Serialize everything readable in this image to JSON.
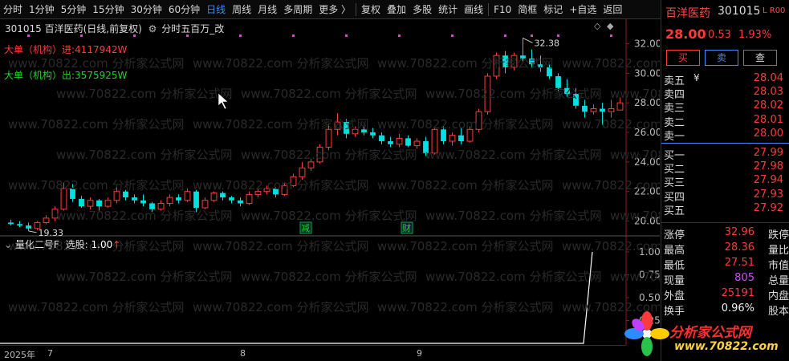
{
  "toolbar": {
    "items": [
      {
        "label": "分时",
        "active": false
      },
      {
        "label": "1分钟",
        "active": false
      },
      {
        "label": "5分钟",
        "active": false
      },
      {
        "label": "15分钟",
        "active": false
      },
      {
        "label": "30分钟",
        "active": false
      },
      {
        "label": "60分钟",
        "active": false
      },
      {
        "label": "日线",
        "active": true
      },
      {
        "label": "周线",
        "active": false
      },
      {
        "label": "月线",
        "active": false
      },
      {
        "label": "多周期",
        "active": false
      },
      {
        "label": "更多 〉",
        "active": false
      },
      {
        "label": "复权",
        "active": false
      },
      {
        "label": "叠加",
        "active": false
      },
      {
        "label": "多股",
        "active": false
      },
      {
        "label": "统计",
        "active": false
      },
      {
        "label": "画线",
        "active": false
      },
      {
        "label": "F10",
        "active": false
      },
      {
        "label": "简框",
        "active": false
      },
      {
        "label": "标记",
        "active": false
      },
      {
        "label": "+自选",
        "active": false
      },
      {
        "label": "返回",
        "active": false
      }
    ]
  },
  "chart": {
    "title": "301015 百洋医药(日线,前复权)",
    "indicator": "分时五百万_改",
    "buy_legend": "大单（机构）进:4117942W",
    "sell_legend": "大单（机构）出:3575925W",
    "pane_label": "量化二号F",
    "pane_select": "选股:",
    "pane_value": "1.00",
    "pane_arrow": "↑",
    "date_labels": [
      "2025年",
      "7",
      "8",
      "9"
    ],
    "high_label": "32.38",
    "low_label": "19.33",
    "event_tags": [
      "减",
      "财"
    ]
  },
  "chart_data": {
    "type": "candlestick",
    "price_ticks": [
      "32.00",
      "30.00",
      "28.00",
      "26.00",
      "24.00",
      "22.00",
      "20.00"
    ],
    "indicator_ticks": [
      "1.00",
      "0.75",
      "0.50",
      "0.25"
    ],
    "candles": [
      {
        "o": 19.9,
        "h": 20.1,
        "l": 19.7,
        "c": 19.8
      },
      {
        "o": 19.8,
        "h": 20.0,
        "l": 19.6,
        "c": 19.7
      },
      {
        "o": 19.7,
        "h": 19.9,
        "l": 19.33,
        "c": 19.5
      },
      {
        "o": 19.5,
        "h": 20.0,
        "l": 19.4,
        "c": 19.9
      },
      {
        "o": 19.9,
        "h": 20.4,
        "l": 19.8,
        "c": 20.2
      },
      {
        "o": 20.2,
        "h": 21.0,
        "l": 20.0,
        "c": 20.8
      },
      {
        "o": 20.8,
        "h": 22.6,
        "l": 20.7,
        "c": 22.2
      },
      {
        "o": 22.2,
        "h": 22.5,
        "l": 21.3,
        "c": 21.5
      },
      {
        "o": 21.5,
        "h": 21.7,
        "l": 20.9,
        "c": 21.0
      },
      {
        "o": 21.0,
        "h": 21.6,
        "l": 20.8,
        "c": 21.4
      },
      {
        "o": 21.4,
        "h": 21.5,
        "l": 20.7,
        "c": 21.0
      },
      {
        "o": 21.0,
        "h": 21.6,
        "l": 20.9,
        "c": 21.4
      },
      {
        "o": 21.4,
        "h": 22.4,
        "l": 21.2,
        "c": 22.0
      },
      {
        "o": 22.0,
        "h": 22.1,
        "l": 21.4,
        "c": 21.6
      },
      {
        "o": 21.6,
        "h": 21.8,
        "l": 21.2,
        "c": 21.4
      },
      {
        "o": 21.4,
        "h": 21.8,
        "l": 21.0,
        "c": 21.2
      },
      {
        "o": 21.2,
        "h": 21.3,
        "l": 20.6,
        "c": 20.8
      },
      {
        "o": 20.8,
        "h": 21.4,
        "l": 20.7,
        "c": 21.2
      },
      {
        "o": 21.2,
        "h": 21.8,
        "l": 21.0,
        "c": 21.6
      },
      {
        "o": 21.6,
        "h": 21.8,
        "l": 21.2,
        "c": 21.4
      },
      {
        "o": 21.4,
        "h": 22.2,
        "l": 21.3,
        "c": 22.0
      },
      {
        "o": 22.0,
        "h": 22.1,
        "l": 20.6,
        "c": 20.9
      },
      {
        "o": 20.9,
        "h": 21.6,
        "l": 20.8,
        "c": 21.4
      },
      {
        "o": 21.4,
        "h": 22.0,
        "l": 21.3,
        "c": 21.9
      },
      {
        "o": 21.9,
        "h": 22.0,
        "l": 21.4,
        "c": 21.6
      },
      {
        "o": 21.6,
        "h": 21.7,
        "l": 21.2,
        "c": 21.4
      },
      {
        "o": 21.4,
        "h": 21.6,
        "l": 21.0,
        "c": 21.2
      },
      {
        "o": 21.2,
        "h": 22.0,
        "l": 21.1,
        "c": 21.8
      },
      {
        "o": 21.8,
        "h": 22.2,
        "l": 21.6,
        "c": 22.0
      },
      {
        "o": 22.0,
        "h": 22.4,
        "l": 21.8,
        "c": 22.2
      },
      {
        "o": 22.2,
        "h": 22.3,
        "l": 21.6,
        "c": 21.8
      },
      {
        "o": 21.8,
        "h": 22.6,
        "l": 21.7,
        "c": 22.4
      },
      {
        "o": 22.4,
        "h": 23.2,
        "l": 22.3,
        "c": 23.0
      },
      {
        "o": 23.0,
        "h": 24.0,
        "l": 22.8,
        "c": 23.6
      },
      {
        "o": 23.6,
        "h": 24.2,
        "l": 23.4,
        "c": 24.0
      },
      {
        "o": 24.0,
        "h": 25.2,
        "l": 23.9,
        "c": 25.0
      },
      {
        "o": 25.0,
        "h": 26.6,
        "l": 24.8,
        "c": 26.2
      },
      {
        "o": 26.2,
        "h": 27.3,
        "l": 25.8,
        "c": 26.7
      },
      {
        "o": 26.7,
        "h": 26.9,
        "l": 25.6,
        "c": 25.9
      },
      {
        "o": 25.9,
        "h": 26.4,
        "l": 25.7,
        "c": 26.2
      },
      {
        "o": 26.2,
        "h": 26.5,
        "l": 25.8,
        "c": 26.0
      },
      {
        "o": 26.0,
        "h": 26.3,
        "l": 25.6,
        "c": 25.8
      },
      {
        "o": 25.8,
        "h": 26.0,
        "l": 25.2,
        "c": 25.4
      },
      {
        "o": 25.4,
        "h": 25.7,
        "l": 25.0,
        "c": 25.2
      },
      {
        "o": 25.2,
        "h": 25.9,
        "l": 25.0,
        "c": 25.6
      },
      {
        "o": 25.6,
        "h": 25.8,
        "l": 25.0,
        "c": 25.1
      },
      {
        "o": 25.1,
        "h": 25.6,
        "l": 24.9,
        "c": 25.4
      },
      {
        "o": 25.4,
        "h": 25.7,
        "l": 24.4,
        "c": 24.6
      },
      {
        "o": 24.6,
        "h": 26.4,
        "l": 24.5,
        "c": 26.2
      },
      {
        "o": 26.2,
        "h": 26.4,
        "l": 25.2,
        "c": 25.4
      },
      {
        "o": 25.4,
        "h": 26.0,
        "l": 25.1,
        "c": 25.8
      },
      {
        "o": 25.8,
        "h": 26.3,
        "l": 25.2,
        "c": 25.4
      },
      {
        "o": 25.4,
        "h": 26.4,
        "l": 25.3,
        "c": 26.2
      },
      {
        "o": 26.2,
        "h": 27.6,
        "l": 26.0,
        "c": 27.4
      },
      {
        "o": 27.4,
        "h": 30.0,
        "l": 27.2,
        "c": 29.8
      },
      {
        "o": 29.8,
        "h": 31.4,
        "l": 29.6,
        "c": 31.2
      },
      {
        "o": 31.2,
        "h": 31.5,
        "l": 30.0,
        "c": 30.4
      },
      {
        "o": 30.4,
        "h": 31.4,
        "l": 30.2,
        "c": 31.2
      },
      {
        "o": 31.2,
        "h": 32.38,
        "l": 30.8,
        "c": 31.0
      },
      {
        "o": 31.0,
        "h": 31.6,
        "l": 30.4,
        "c": 30.6
      },
      {
        "o": 30.6,
        "h": 31.2,
        "l": 30.1,
        "c": 30.4
      },
      {
        "o": 30.4,
        "h": 30.6,
        "l": 29.6,
        "c": 29.8
      },
      {
        "o": 29.8,
        "h": 30.0,
        "l": 28.8,
        "c": 29.0
      },
      {
        "o": 29.0,
        "h": 29.6,
        "l": 28.4,
        "c": 28.6
      },
      {
        "o": 28.6,
        "h": 29.0,
        "l": 27.6,
        "c": 27.8
      },
      {
        "o": 27.8,
        "h": 28.2,
        "l": 27.0,
        "c": 27.4
      },
      {
        "o": 27.4,
        "h": 27.9,
        "l": 27.2,
        "c": 27.6
      },
      {
        "o": 27.6,
        "h": 28.0,
        "l": 26.5,
        "c": 27.4
      },
      {
        "o": 27.4,
        "h": 28.2,
        "l": 27.0,
        "c": 27.6
      },
      {
        "o": 27.51,
        "h": 28.36,
        "l": 27.51,
        "c": 28.0
      }
    ],
    "signal": {
      "values_tail": [
        0,
        0,
        0,
        1.0
      ]
    }
  },
  "quote": {
    "name": "百洋医药",
    "code": "301015",
    "flags": "L R00",
    "price": "28.00",
    "change": "0.53",
    "change_pct": "1.93%",
    "btn_buy": "买",
    "btn_sell": "卖",
    "btn_more": "查",
    "asks": [
      {
        "label": "卖五",
        "price": "28.04",
        "yen": "¥"
      },
      {
        "label": "卖四",
        "price": "28.03",
        "yen": ""
      },
      {
        "label": "卖三",
        "price": "28.02",
        "yen": ""
      },
      {
        "label": "卖二",
        "price": "28.01",
        "yen": ""
      },
      {
        "label": "卖一",
        "price": "28.00",
        "yen": ""
      }
    ],
    "bids": [
      {
        "label": "买一",
        "price": "27.99"
      },
      {
        "label": "买二",
        "price": "27.98"
      },
      {
        "label": "买三",
        "price": "27.94"
      },
      {
        "label": "买四",
        "price": "27.93"
      },
      {
        "label": "买五",
        "price": "27.92"
      }
    ],
    "stats": [
      {
        "label": "涨停",
        "value": "32.96",
        "label2": "跌停",
        "color": "red"
      },
      {
        "label": "最高",
        "value": "28.36",
        "label2": "量比",
        "color": "red"
      },
      {
        "label": "最低",
        "value": "27.51",
        "label2": "市值",
        "color": "red"
      },
      {
        "label": "现量",
        "value": "805",
        "label2": "总量",
        "color": "purple"
      },
      {
        "label": "外盘",
        "value": "25191",
        "label2": "内盘",
        "color": "red"
      },
      {
        "label": "换手",
        "value": "0.96%",
        "label2": "股本",
        "color": "white"
      }
    ]
  },
  "watermark": {
    "text": "www.70822.com 分析家公式网",
    "logo_text": "分析家公式网",
    "logo_url": "www.70822.com"
  },
  "colors": {
    "up": "#ff3b3b",
    "down": "#00e0e0",
    "grid": "#8b1c1c",
    "active": "#3b8cff"
  }
}
